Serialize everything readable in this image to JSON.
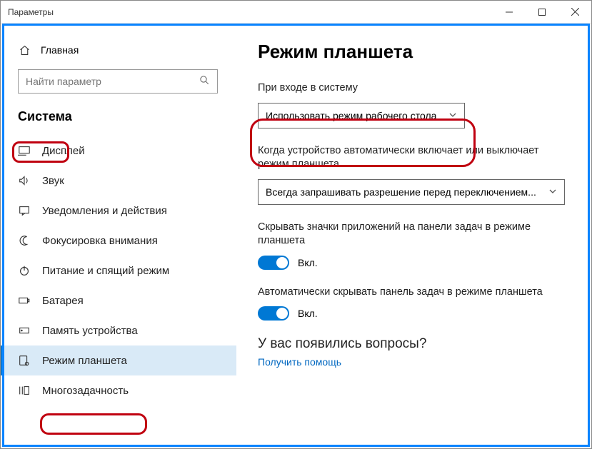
{
  "window": {
    "title": "Параметры"
  },
  "sidebar": {
    "home": "Главная",
    "searchPlaceholder": "Найти параметр",
    "section": "Система",
    "items": [
      {
        "label": "Дисплей"
      },
      {
        "label": "Звук"
      },
      {
        "label": "Уведомления и действия"
      },
      {
        "label": "Фокусировка внимания"
      },
      {
        "label": "Питание и спящий режим"
      },
      {
        "label": "Батарея"
      },
      {
        "label": "Память устройства"
      },
      {
        "label": "Режим планшета"
      },
      {
        "label": "Многозадачность"
      }
    ]
  },
  "page": {
    "title": "Режим планшета",
    "signin": {
      "label": "При входе в систему",
      "value": "Использовать режим рабочего стола"
    },
    "autoSwitch": {
      "label": "Когда устройство автоматически включает или выключает режим планшета",
      "value": "Всегда запрашивать разрешение перед переключением..."
    },
    "hideIcons": {
      "label": "Скрывать значки приложений на панели задач в режиме планшета",
      "state": "Вкл."
    },
    "hideTaskbar": {
      "label": "Автоматически скрывать панель задач в режиме планшета",
      "state": "Вкл."
    },
    "help": {
      "heading": "У вас появились вопросы?",
      "link": "Получить помощь"
    }
  }
}
